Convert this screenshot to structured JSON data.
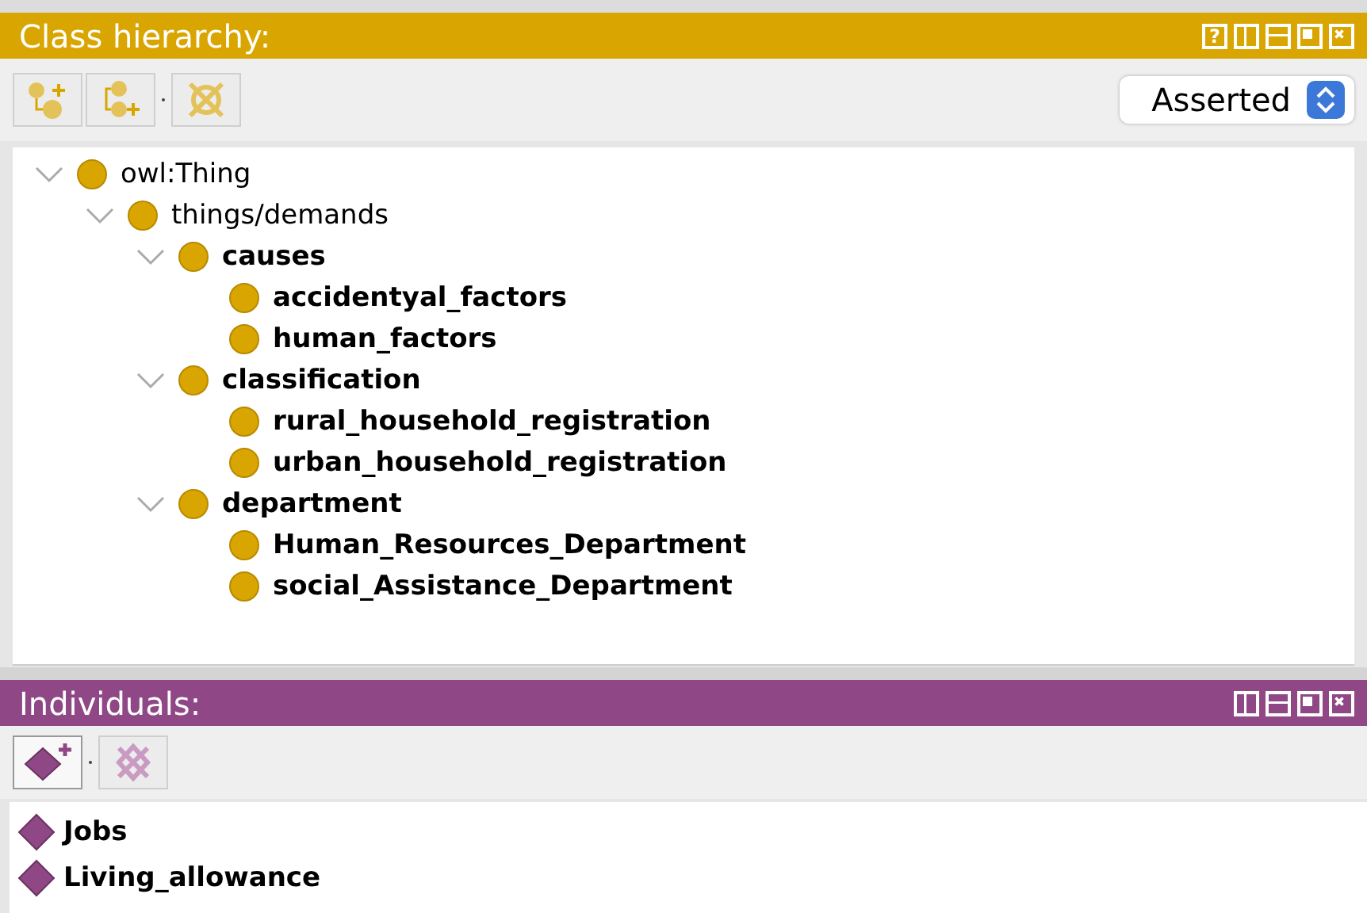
{
  "class_panel": {
    "title": "Class hierarchy:",
    "help": "?",
    "view_select": {
      "value": "Asserted"
    },
    "tree": [
      {
        "label": "owl:Thing",
        "bold": false,
        "expanded": true,
        "children": [
          {
            "label": "things/demands",
            "bold": false,
            "expanded": true,
            "children": [
              {
                "label": "causes",
                "bold": true,
                "expanded": true,
                "children": [
                  {
                    "label": "accidentyal_factors",
                    "bold": true,
                    "expanded": false
                  },
                  {
                    "label": "human_factors",
                    "bold": true,
                    "expanded": false
                  }
                ]
              },
              {
                "label": "classification",
                "bold": true,
                "expanded": true,
                "children": [
                  {
                    "label": "rural_household_registration",
                    "bold": true,
                    "expanded": false
                  },
                  {
                    "label": "urban_household_registration",
                    "bold": true,
                    "expanded": false
                  }
                ]
              },
              {
                "label": "department",
                "bold": true,
                "expanded": true,
                "children": [
                  {
                    "label": "Human_Resources_Department",
                    "bold": true,
                    "expanded": false
                  },
                  {
                    "label": "social_Assistance_Department",
                    "bold": true,
                    "expanded": false
                  }
                ]
              }
            ]
          }
        ]
      }
    ]
  },
  "individuals_panel": {
    "title": "Individuals:",
    "items": [
      {
        "label": "Jobs"
      },
      {
        "label": "Living_allowance"
      }
    ]
  }
}
